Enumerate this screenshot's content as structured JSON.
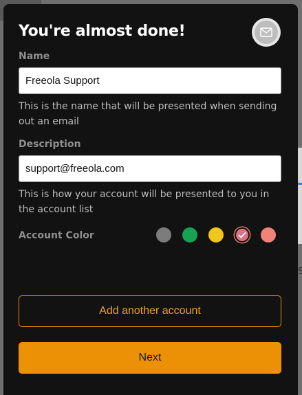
{
  "dialog": {
    "title": "You're almost done!",
    "icon": "mail-icon"
  },
  "name": {
    "label": "Name",
    "value": "Freeola Support",
    "help": "This is the name that will be presented when sending out an email"
  },
  "description": {
    "label": "Description",
    "value": "support@freeola.com",
    "help": "This is how your account will be presented to you in the account list"
  },
  "account_color": {
    "label": "Account Color",
    "swatches": [
      {
        "name": "gray",
        "hex": "#7c7c7c",
        "selected": false
      },
      {
        "name": "green",
        "hex": "#17a253",
        "selected": false
      },
      {
        "name": "yellow",
        "hex": "#eec71a",
        "selected": false
      },
      {
        "name": "pink",
        "hex": "#d97387",
        "selected": true
      },
      {
        "name": "salmon",
        "hex": "#f08379",
        "selected": false
      }
    ]
  },
  "actions": {
    "add_account_label": "Add another account",
    "next_label": "Next"
  },
  "colors": {
    "accent": "#ec9106",
    "modal_bg": "#121212"
  }
}
